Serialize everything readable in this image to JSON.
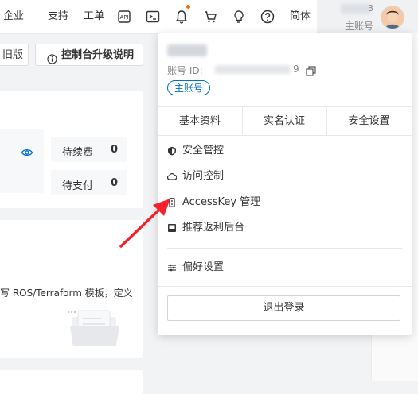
{
  "topbar": {
    "enterprise": "企业",
    "support": "支持",
    "ticket": "工单",
    "api_icon": "api-icon",
    "terminal_icon": "terminal-icon",
    "bell_icon": "bell-icon",
    "cart_icon": "cart-icon",
    "bulb_icon": "lightbulb-icon",
    "help_icon": "help-icon",
    "language": "简体",
    "account_tail": "3",
    "account_role": "主账号",
    "notify_color": "#ff6a00"
  },
  "content": {
    "tab_old_version": "旧版",
    "tab_upgrade": "控制台升级说明",
    "pending_renew_label": "待续费",
    "pending_renew_value": "0",
    "pending_pay_label": "待支付",
    "pending_pay_value": "0",
    "ros_text": "写 ROS/Terraform 模板，定义"
  },
  "dropdown": {
    "id_label": "账号 ID:",
    "id_tail": "9",
    "role_badge": "主账号",
    "tabs": [
      "基本资料",
      "实名认证",
      "安全设置"
    ],
    "items": [
      {
        "label": "安全管控",
        "icon": "shield-icon"
      },
      {
        "label": "访问控制",
        "icon": "cloud-icon"
      },
      {
        "label": "AccessKey 管理",
        "icon": "key-icon"
      },
      {
        "label": "推荐返利后台",
        "icon": "gift-icon"
      },
      {
        "label": "偏好设置",
        "icon": "sliders-icon"
      }
    ],
    "logout": "退出登录"
  },
  "colors": {
    "accent": "#0070cc",
    "arrow": "#f5222d"
  }
}
